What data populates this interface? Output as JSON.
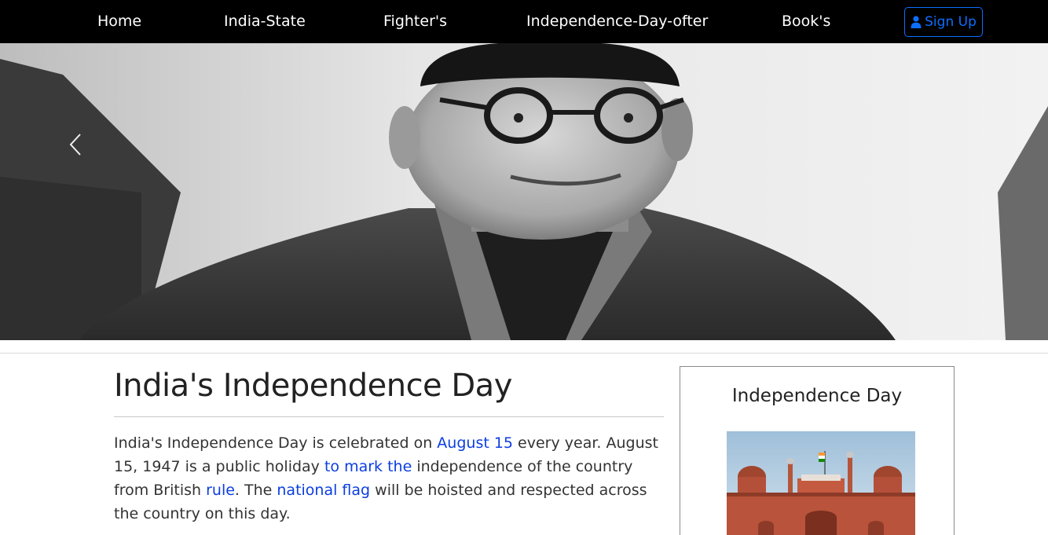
{
  "nav": {
    "items": [
      {
        "label": "Home"
      },
      {
        "label": "India-State"
      },
      {
        "label": "Fighter's"
      },
      {
        "label": "Independence-Day-ofter"
      },
      {
        "label": "Book's"
      }
    ],
    "signup_label": "Sign Up",
    "signup_icon": "user-icon"
  },
  "hero": {
    "prev_icon": "chevron-left-icon"
  },
  "article": {
    "title": "India's Independence Day",
    "p1": "India's Independence Day is celebrated on ",
    "link1": "August 15",
    "p2": " every year. August 15, 1947 is a public holiday ",
    "link2": "to mark the",
    "p3": " independence of the country from British ",
    "link3": "rule",
    "p4": ". The ",
    "link4": "national flag",
    "p5": " will be hoisted and respected across the country on this day."
  },
  "sidebar": {
    "title": "Independence Day"
  },
  "colors": {
    "nav_bg": "#000000",
    "accent": "#0d6efd",
    "link": "#0b3ee0"
  }
}
